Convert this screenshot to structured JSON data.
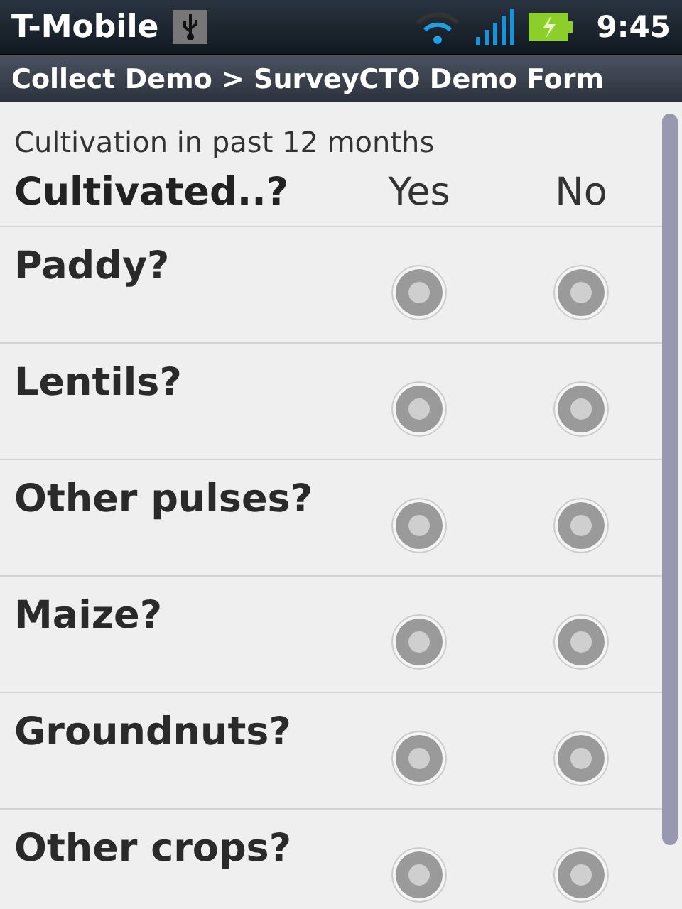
{
  "status_bar": {
    "carrier": "T-Mobile",
    "time": "9:45"
  },
  "title_bar": {
    "title": "Collect Demo > SurveyCTO Demo Form"
  },
  "group_label": "Cultivation in past 12 months",
  "table": {
    "header": "Cultivated..?",
    "options": [
      "Yes",
      "No"
    ],
    "rows": [
      {
        "label": "Paddy?",
        "choices": [
          {
            "selected": false
          },
          {
            "selected": false
          }
        ]
      },
      {
        "label": "Lentils?",
        "choices": [
          {
            "selected": false
          },
          {
            "selected": false
          }
        ]
      },
      {
        "label": "Other pulses?",
        "choices": [
          {
            "selected": false
          },
          {
            "selected": false
          }
        ]
      },
      {
        "label": "Maize?",
        "choices": [
          {
            "selected": false
          },
          {
            "selected": false
          }
        ]
      },
      {
        "label": "Groundnuts?",
        "choices": [
          {
            "selected": false
          },
          {
            "selected": false
          }
        ]
      },
      {
        "label": "Other crops?",
        "choices": [
          {
            "selected": false
          },
          {
            "selected": false
          }
        ]
      }
    ]
  }
}
